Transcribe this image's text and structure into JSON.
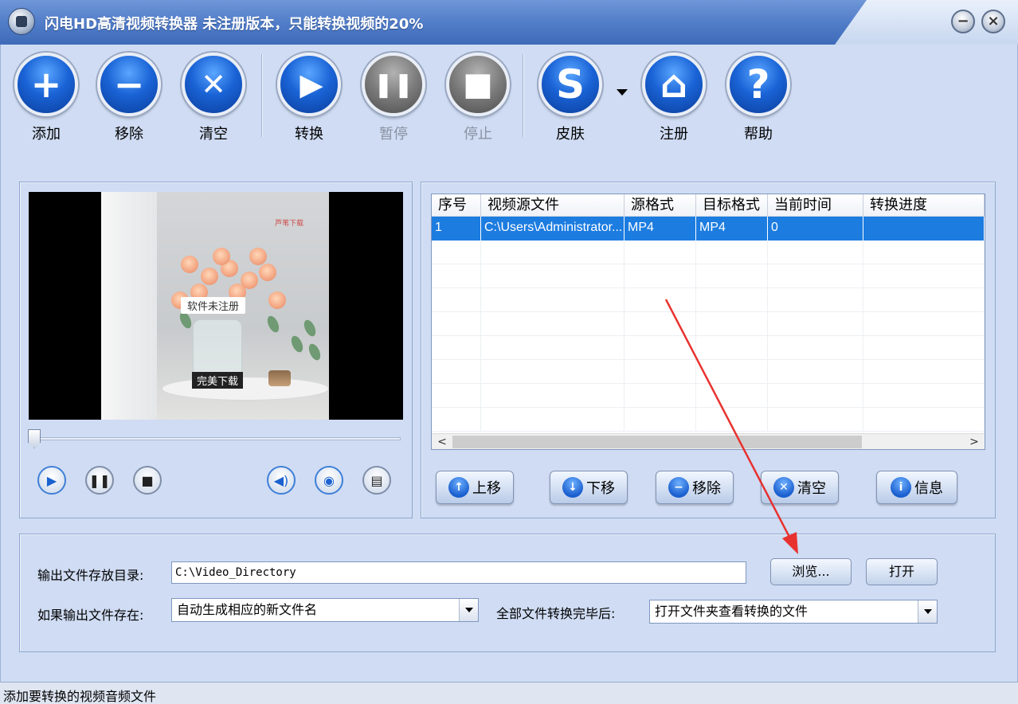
{
  "window": {
    "title": "闪电HD高清视频转换器  未注册版本，只能转换视频的20%",
    "min_label": "−",
    "close_label": "×"
  },
  "toolbar": {
    "items": [
      {
        "label": "添加",
        "icon": "plus-icon",
        "glyph": "+"
      },
      {
        "label": "移除",
        "icon": "minus-icon",
        "glyph": "−"
      },
      {
        "label": "清空",
        "icon": "clear-x-icon",
        "glyph": "✕"
      },
      {
        "label": "转换",
        "icon": "play-icon",
        "glyph": "▶"
      },
      {
        "label": "暂停",
        "icon": "pause-icon",
        "glyph": "❚❚",
        "disabled": true
      },
      {
        "label": "停止",
        "icon": "stop-icon",
        "glyph": "■",
        "disabled": true
      },
      {
        "label": "皮肤",
        "icon": "skin-s-icon",
        "glyph": "S"
      },
      {
        "label": "注册",
        "icon": "home-icon",
        "glyph": "⌂"
      },
      {
        "label": "帮助",
        "icon": "help-icon",
        "glyph": "?"
      }
    ]
  },
  "preview": {
    "watermark_top": "芦苇下载",
    "caption_1": "软件未注册",
    "caption_2": "完美下载",
    "progress": 0
  },
  "file_list": {
    "columns": [
      "序号",
      "视频源文件",
      "源格式",
      "目标格式",
      "当前时间",
      "转换进度"
    ],
    "rows": [
      [
        "1",
        "C:\\Users\\Administrator...",
        "MP4",
        "MP4",
        "0",
        ""
      ]
    ],
    "scroll_left": "<",
    "scroll_right": ">",
    "buttons": [
      {
        "label": "上移",
        "glyph": "↑"
      },
      {
        "label": "下移",
        "glyph": "↓"
      },
      {
        "label": "移除",
        "glyph": "−"
      },
      {
        "label": "清空",
        "glyph": "✕"
      },
      {
        "label": "信息",
        "glyph": "i"
      }
    ]
  },
  "output": {
    "dir_label": "输出文件存放目录:",
    "dir_value": "C:\\Video_Directory",
    "browse_label": "浏览...",
    "open_label": "打开",
    "exists_label": "如果输出文件存在:",
    "exists_value": "自动生成相应的新文件名",
    "after_label": "全部文件转换完毕后:",
    "after_value": "打开文件夹查看转换的文件"
  },
  "status": {
    "text": "添加要转换的视频音频文件"
  },
  "colors": {
    "accent": "#1c7ce0",
    "annotation_arrow": "#e8322f"
  }
}
